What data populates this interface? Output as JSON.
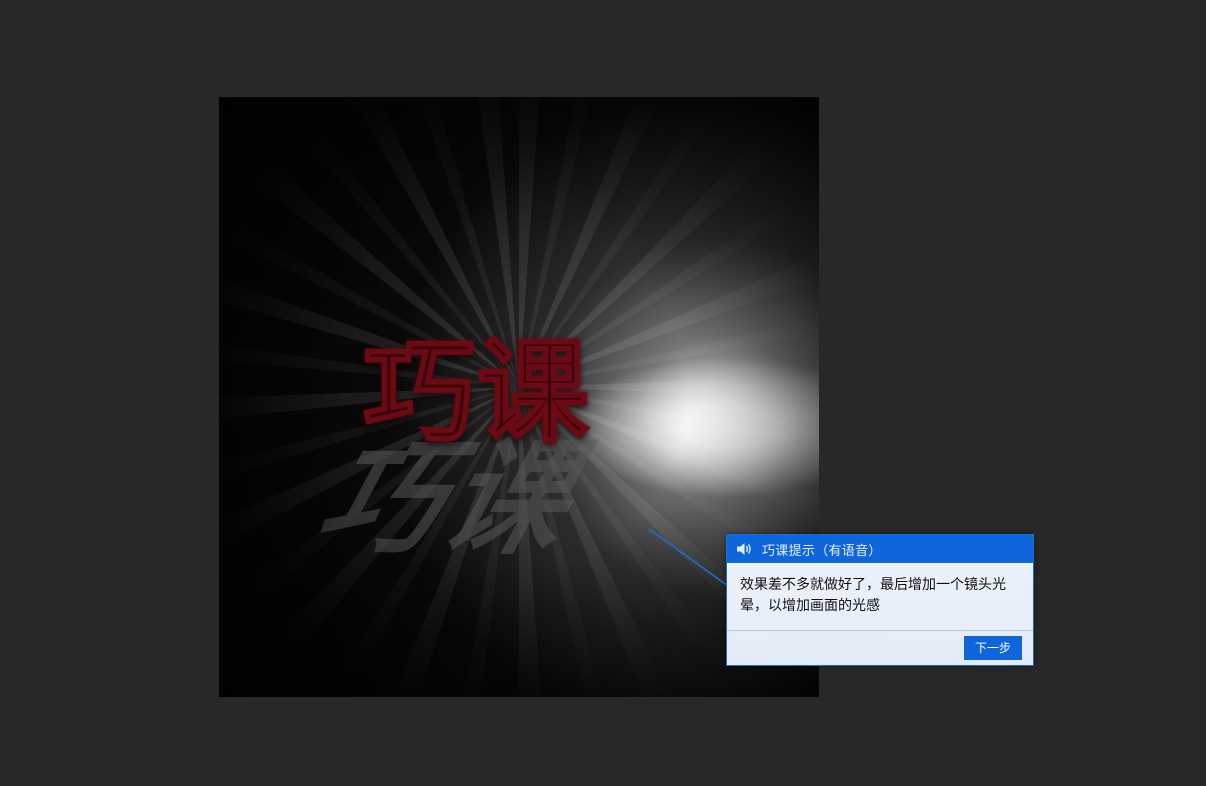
{
  "canvas": {
    "artwork_title": "巧课"
  },
  "tip": {
    "icon": "speaker-icon",
    "title": "巧课提示（有语音）",
    "message": "效果差不多就做好了，最后增加一个镜头光晕，以增加画面的光感",
    "next_label": "下一步"
  },
  "colors": {
    "workspace_bg": "#282828",
    "tip_header": "#0f66dc",
    "tip_body_bg": "#eef3fb",
    "title_red": "#3a0307"
  }
}
